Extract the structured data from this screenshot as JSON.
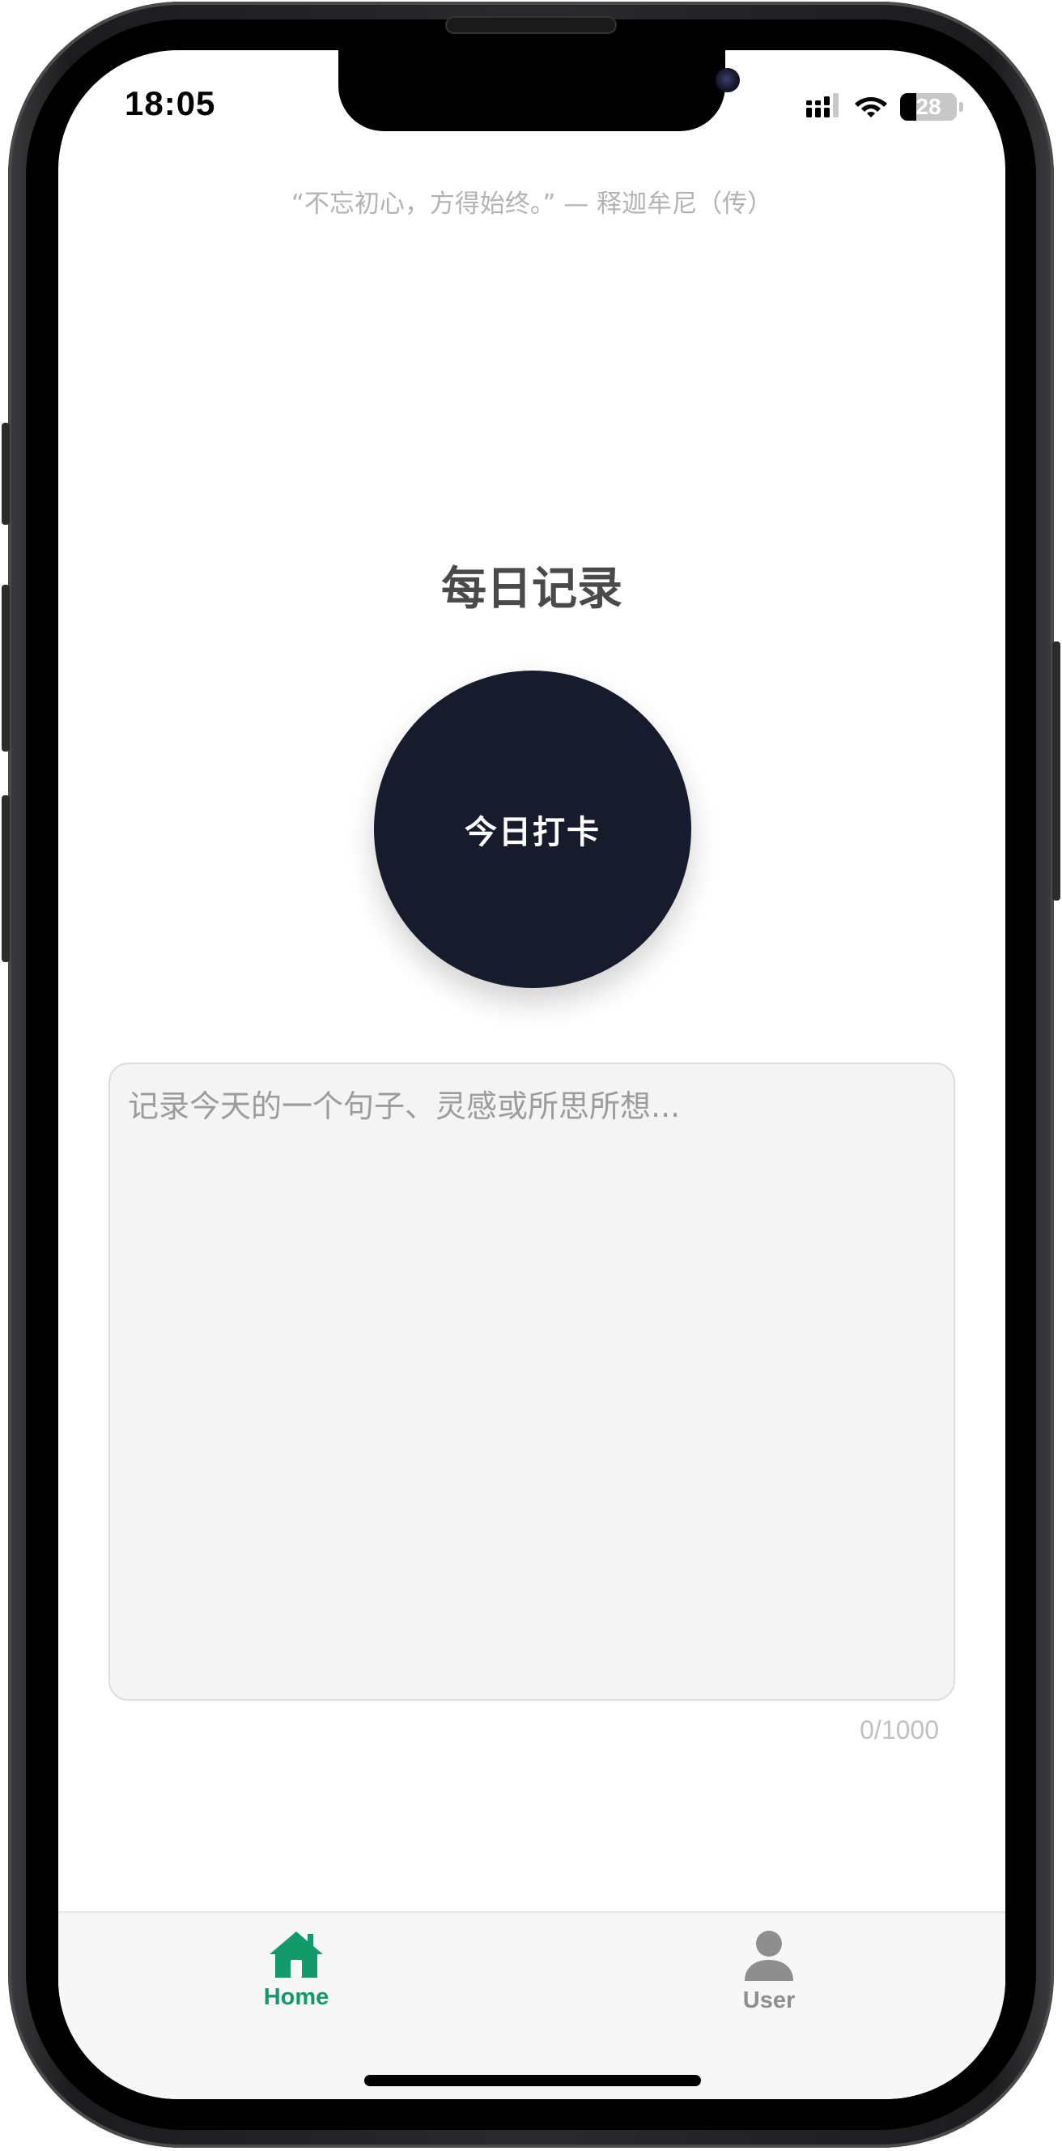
{
  "status_bar": {
    "time": "18:05",
    "battery_level": "28",
    "battery_fraction": 0.28,
    "icons": [
      "signal-icon",
      "wifi-icon",
      "battery-icon"
    ]
  },
  "quote": "“不忘初心，方得始终。” — 释迦牟尼（传）",
  "main": {
    "title": "每日记录",
    "checkin_button_label": "今日打卡",
    "note": {
      "placeholder": "记录今天的一个句子、灵感或所思所想...",
      "value": "",
      "char_count": "0/1000"
    }
  },
  "tabbar": {
    "items": [
      {
        "label": "Home",
        "icon": "home-icon",
        "active": true
      },
      {
        "label": "User",
        "icon": "user-icon",
        "active": false
      }
    ]
  },
  "colors": {
    "accent": "#14996a",
    "button_bg": "#171c2c",
    "inactive_tab": "#8e8e8e"
  }
}
